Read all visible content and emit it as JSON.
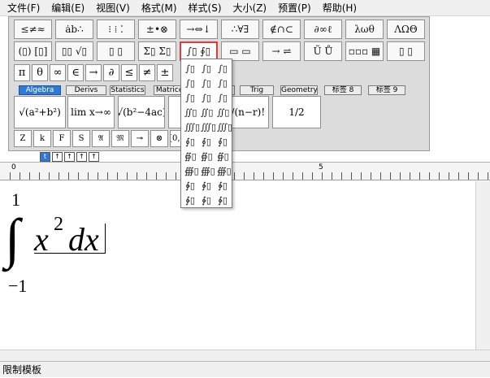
{
  "menu": [
    "文件(F)",
    "编辑(E)",
    "视图(V)",
    "格式(M)",
    "样式(S)",
    "大小(Z)",
    "预置(P)",
    "帮助(H)"
  ],
  "toolbar_row1": [
    "≤≠≈",
    "ȧb∴",
    "⁝ ⁞ ⁚",
    "±•⊗",
    "→⇔↓",
    "∴∀∃",
    "∉∩⊂",
    "∂∞ℓ",
    "λωθ",
    "ΛΩΘ"
  ],
  "toolbar_row2": [
    "(▯) [▯]",
    "▯▯ √▯",
    "▯ ▯",
    "Σ▯ Σ▯",
    "∫▯ ∮▯",
    "▭ ▭",
    "→ ⇌",
    "Ũ Ů",
    "▫▫▫ ▦",
    "▯ ▯"
  ],
  "toolbar_row2_active_index": 4,
  "symbols": [
    "π",
    "θ",
    "∞",
    "∈",
    "→",
    "∂",
    "≤",
    "≠",
    "±"
  ],
  "tabs": [
    "Algebra",
    "Derivs",
    "Statistics",
    "Matrices",
    "Sets",
    "Trig",
    "Geometry",
    "标签 8",
    "标签 9"
  ],
  "tabs_selected_index": 0,
  "templates": [
    "√(a²+b²)",
    "lim x→∞",
    "√(b²−4ac)",
    "−b",
    "n!/(n−r)!",
    "1/2"
  ],
  "small_row": [
    "Z",
    "k",
    "F",
    "S",
    "𝔄",
    "𝔐",
    "⊸",
    "⊗",
    "[0,1]",
    "∞",
    "√2"
  ],
  "size_buttons": [
    "t",
    "↑",
    "↑",
    "↑",
    "↑"
  ],
  "ruler_numbers": [
    "0",
    "5"
  ],
  "dropdown_items": [
    "∫▯",
    "∫▯",
    "∫▯",
    "∫▯",
    "∫▯",
    "∫▯",
    "∫▯",
    "∫▯",
    "∫▯",
    "∬▯",
    "∬▯",
    "∬▯",
    "∭▯",
    "∭▯",
    "∭▯",
    "∮▯",
    "∮▯",
    "∮▯",
    "∯▯",
    "∯▯",
    "∯▯",
    "∰▯",
    "∰▯",
    "∰▯",
    "∲▯",
    "∲▯",
    "∲▯",
    "∳▯",
    "∳▯",
    "∳▯"
  ],
  "equation": {
    "upper": "1",
    "lower": "−1",
    "integrand": "x",
    "exponent": "2",
    "differential": "dx"
  },
  "status_text": "限制模板"
}
